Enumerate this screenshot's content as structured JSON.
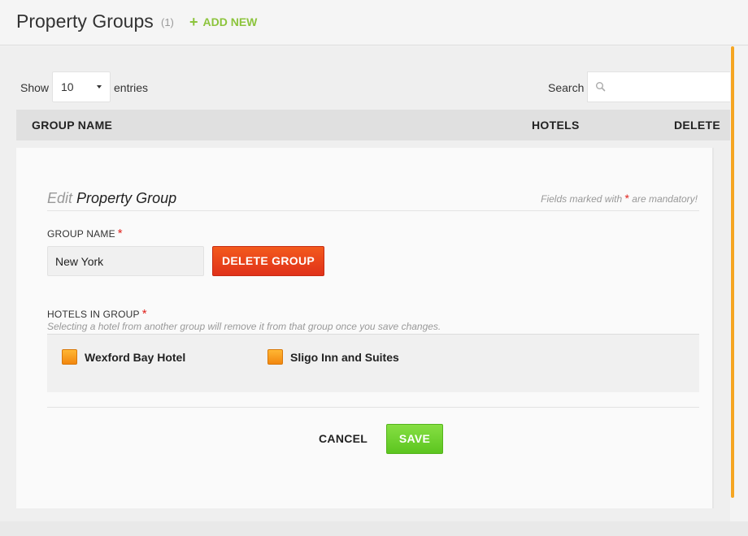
{
  "header": {
    "title": "Property Groups",
    "count": "(1)",
    "add_new_label": "ADD NEW"
  },
  "table_controls": {
    "show_label": "Show",
    "entries_value": "10",
    "entries_label": "entries",
    "search_label": "Search",
    "search_value": ""
  },
  "table": {
    "columns": [
      "GROUP NAME",
      "HOTELS",
      "DELETE"
    ]
  },
  "edit_form": {
    "title_light": "Edit",
    "title_main": "Property Group",
    "mandatory_prefix": "Fields marked with",
    "mandatory_star": "*",
    "mandatory_suffix": "are mandatory!",
    "group_name_label": "GROUP NAME",
    "group_name_value": "New York",
    "delete_group_label": "DELETE GROUP",
    "hotels_label": "HOTELS IN GROUP",
    "hotels_hint": "Selecting a hotel from another group will remove it from that group once you save changes.",
    "hotels": [
      {
        "name": "Wexford Bay Hotel",
        "checked": true
      },
      {
        "name": "Sligo Inn and Suites",
        "checked": true
      }
    ],
    "cancel_label": "CANCEL",
    "save_label": "SAVE"
  },
  "colors": {
    "accent_green": "#8cc43c",
    "delete_red": "#e0311a",
    "save_green": "#5cc51f",
    "checkbox_orange": "#f2870f",
    "scroll_accent": "#f5a623",
    "required_star": "#e0221c"
  }
}
